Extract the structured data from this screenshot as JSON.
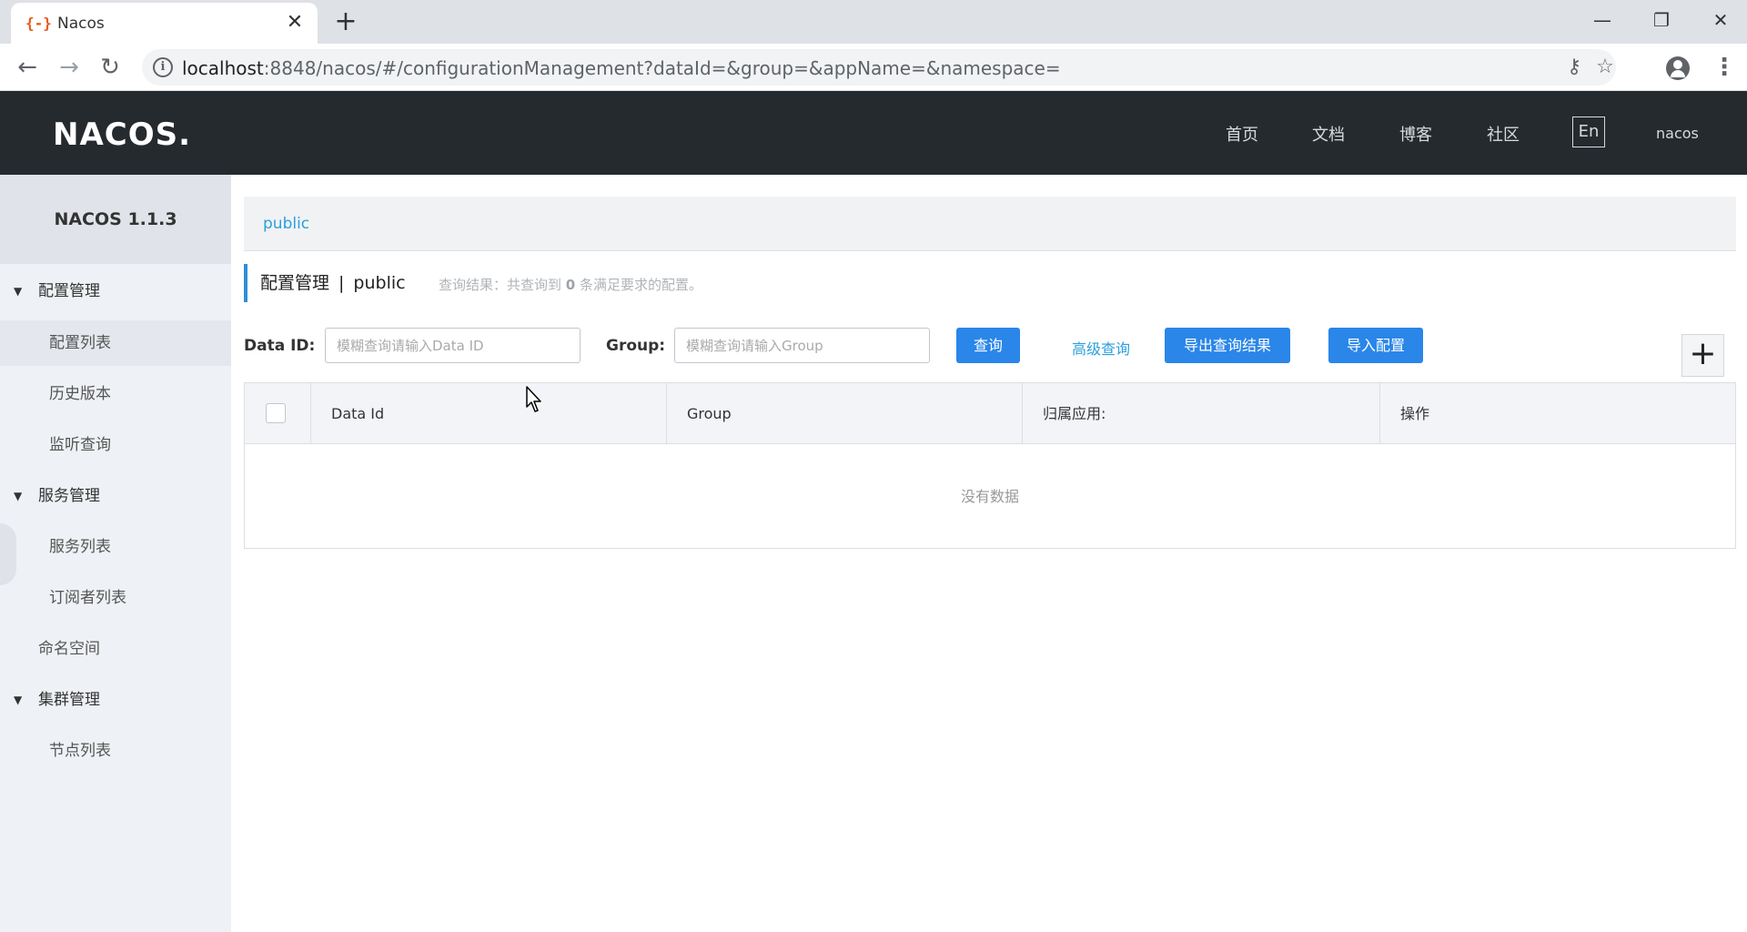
{
  "browser": {
    "tab_title": "Nacos",
    "tab_favicon": "{-}",
    "close_glyph": "✕",
    "newtab_glyph": "+",
    "url_host": "localhost",
    "url_rest": ":8848/nacos/#/configurationManagement?dataId=&group=&appName=&namespace=",
    "icons": {
      "back": "back-arrow-icon",
      "forward": "forward-arrow-icon",
      "reload": "reload-icon",
      "info": "info-icon",
      "key": "key-icon",
      "star": "star-icon",
      "profile": "profile-icon",
      "menu": "more-vert-icon"
    }
  },
  "header": {
    "logo": "NACOS.",
    "nav": [
      "首页",
      "文档",
      "博客",
      "社区"
    ],
    "lang": "En",
    "user": "nacos"
  },
  "sidebar": {
    "title": "NACOS 1.1.3",
    "groups": [
      {
        "label": "配置管理",
        "items": [
          "配置列表",
          "历史版本",
          "监听查询"
        ]
      },
      {
        "label": "服务管理",
        "items": [
          "服务列表",
          "订阅者列表"
        ]
      },
      {
        "label": "命名空间"
      },
      {
        "label": "集群管理",
        "items": [
          "节点列表"
        ]
      }
    ]
  },
  "namespace_bar": {
    "active": "public"
  },
  "heading": {
    "title": "配置管理",
    "separator": "|",
    "namespace": "public",
    "result_prefix": "查询结果：共查询到",
    "result_count": "0",
    "result_suffix": "条满足要求的配置。"
  },
  "form": {
    "data_id_label": "Data ID:",
    "data_id_placeholder": "模糊查询请输入Data ID",
    "group_label": "Group:",
    "group_placeholder": "模糊查询请输入Group",
    "query_button": "查询",
    "advanced_query": "高级查询",
    "export_button": "导出查询结果",
    "import_button": "导入配置",
    "add_glyph": "+"
  },
  "table": {
    "columns": [
      "Data Id",
      "Group",
      "归属应用:",
      "操作"
    ],
    "empty_text": "没有数据"
  },
  "colors": {
    "header_bg": "#252a2f",
    "primary": "#2a86e8",
    "link": "#2b9fdc",
    "sidebar_bg": "#eef1f5"
  }
}
